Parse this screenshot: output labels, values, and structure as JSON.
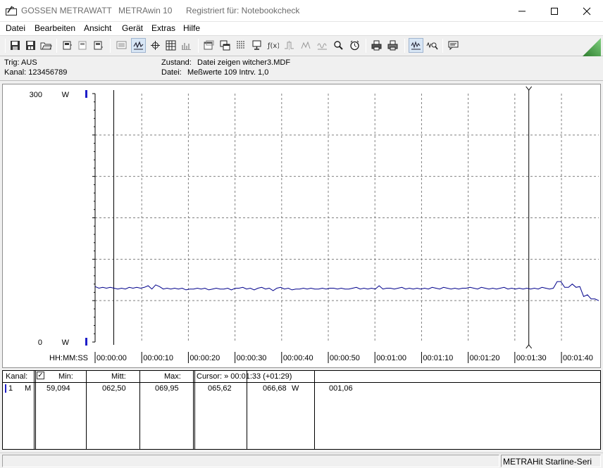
{
  "window": {
    "app_name": "GOSSEN METRAWATT",
    "program": "METRAwin 10",
    "registered": "Registriert für: Notebookcheck"
  },
  "menu": [
    "Datei",
    "Bearbeiten",
    "Ansicht",
    "Gerät",
    "Extras",
    "Hilfe"
  ],
  "toolbar_icons": [
    "save-icon",
    "save-as-icon",
    "open-folder-icon",
    "device-read-icon",
    "device-icon",
    "device-output-icon",
    "list-view-icon",
    "waveform-view-icon",
    "crosshair-icon",
    "table-view-icon",
    "bar-view-icon",
    "window-icon",
    "window-cascade-icon",
    "grid-icon",
    "monitor-icon",
    "function-icon",
    "trigger-icon",
    "signal-icon",
    "zoom-settings-icon",
    "clock-icon",
    "print-icon",
    "print-setup-icon",
    "waveform-zoom-icon",
    "waveform-search-icon",
    "comment-icon"
  ],
  "info": {
    "trig": "Trig: AUS",
    "kanal": "Kanal: 123456789",
    "zustand_label": "Zustand:",
    "zustand_value": "Datei zeigen witcher3.MDF",
    "datei_label": "Datei:",
    "datei_value": "Meßwerte 109   Intrv. 1,0"
  },
  "chart_data": {
    "type": "line",
    "title": "",
    "xlabel": "HH:MM:SS",
    "ylabel": "W",
    "y_top_label": "300",
    "y_bottom_label": "0",
    "unit": "W",
    "ylim": [
      0,
      300
    ],
    "xlim_seconds": [
      0,
      108
    ],
    "x_ticks": [
      "00:00:00",
      "00:00:10",
      "00:00:20",
      "00:00:30",
      "00:00:40",
      "00:00:50",
      "00:01:00",
      "00:01:10",
      "00:01:20",
      "00:01:30",
      "00:01:40"
    ],
    "grid": true,
    "cursor_left_seconds": 4,
    "cursor_right_seconds": 93,
    "series": [
      {
        "color": "#00008b",
        "values": [
          67,
          65,
          66,
          65,
          66,
          65,
          64,
          65,
          64,
          66,
          65,
          66,
          65,
          66,
          68,
          64,
          69,
          67,
          64,
          65,
          64,
          65,
          64,
          65,
          63,
          64,
          64,
          65,
          64,
          65,
          63,
          64,
          65,
          64,
          64,
          65,
          63,
          65,
          65,
          66,
          64,
          65,
          63,
          65,
          66,
          64,
          65,
          62,
          65,
          66,
          64,
          65,
          63,
          64,
          64,
          65,
          64,
          65,
          64,
          64,
          65,
          64,
          65,
          65,
          64,
          65,
          64,
          64,
          65,
          66,
          64,
          65,
          64,
          65,
          64,
          68,
          64,
          65,
          65,
          64,
          65,
          66,
          64,
          65,
          64,
          65,
          64,
          65,
          64,
          66,
          65,
          64,
          66,
          65,
          64,
          65,
          64,
          65,
          65,
          66,
          65,
          64,
          66,
          65,
          64,
          65,
          64,
          65,
          66,
          64,
          65,
          64,
          65,
          64,
          65,
          64,
          65,
          64,
          66,
          65,
          64,
          65,
          73,
          73,
          66,
          66,
          70,
          66,
          67,
          55,
          57,
          52,
          52,
          50
        ]
      }
    ]
  },
  "table": {
    "kanal_header": "Kanal:",
    "check_mark": "✓",
    "min_header": "Min:",
    "mitt_header": "Mitt:",
    "max_header": "Max:",
    "cursor_header": "Cursor: » 00:01:33 (+01:29)",
    "row_channel": "1",
    "row_mode": "M",
    "min_value": "59,094",
    "mitt_value": "062,50",
    "max_value": "069,95",
    "cursor_val1": "065,62",
    "cursor_val2": "066,68",
    "cursor_unit": "W",
    "cursor_val3": "001,06"
  },
  "status": {
    "device": "METRAHit Starline-Seri"
  }
}
